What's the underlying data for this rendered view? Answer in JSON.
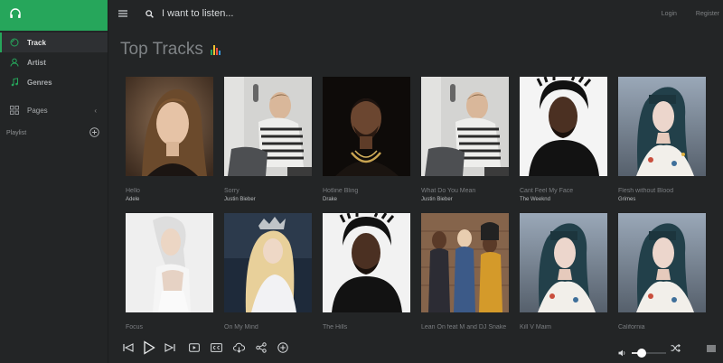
{
  "sidebar": {
    "brand_icon": "headphones-icon",
    "items": [
      {
        "label": "Track",
        "icon": "disc-icon",
        "active": true
      },
      {
        "label": "Artist",
        "icon": "user-icon",
        "active": false
      },
      {
        "label": "Genres",
        "icon": "music-note-icon",
        "active": false
      }
    ],
    "pages": {
      "label": "Pages",
      "icon": "grid-icon"
    },
    "playlist": {
      "label": "Playlist"
    }
  },
  "topbar": {
    "search_placeholder": "I want to listen...",
    "login": "Login",
    "register": "Register"
  },
  "main": {
    "title": "Top Tracks",
    "tracks": [
      {
        "title": "Hello",
        "artist": "Adele"
      },
      {
        "title": "Sorry",
        "artist": "Justin Bieber"
      },
      {
        "title": "Hotline Bling",
        "artist": "Drake"
      },
      {
        "title": "What Do You Mean",
        "artist": "Justin Bieber"
      },
      {
        "title": "Cant Feel My Face",
        "artist": "The Weeknd"
      },
      {
        "title": "Flesh without Blood",
        "artist": "Grimes"
      },
      {
        "title": "Focus",
        "artist": ""
      },
      {
        "title": "On My Mind",
        "artist": ""
      },
      {
        "title": "The Hills",
        "artist": ""
      },
      {
        "title": "Lean On feat M and DJ Snake",
        "artist": ""
      },
      {
        "title": "Kill V Maim",
        "artist": ""
      },
      {
        "title": "California",
        "artist": ""
      }
    ]
  },
  "player": {
    "volume": 0.3
  },
  "colors": {
    "accent": "#26a65b",
    "background": "#232526",
    "bars": [
      "#26a65b",
      "#f0c330",
      "#e84c3d",
      "#3498db"
    ]
  }
}
